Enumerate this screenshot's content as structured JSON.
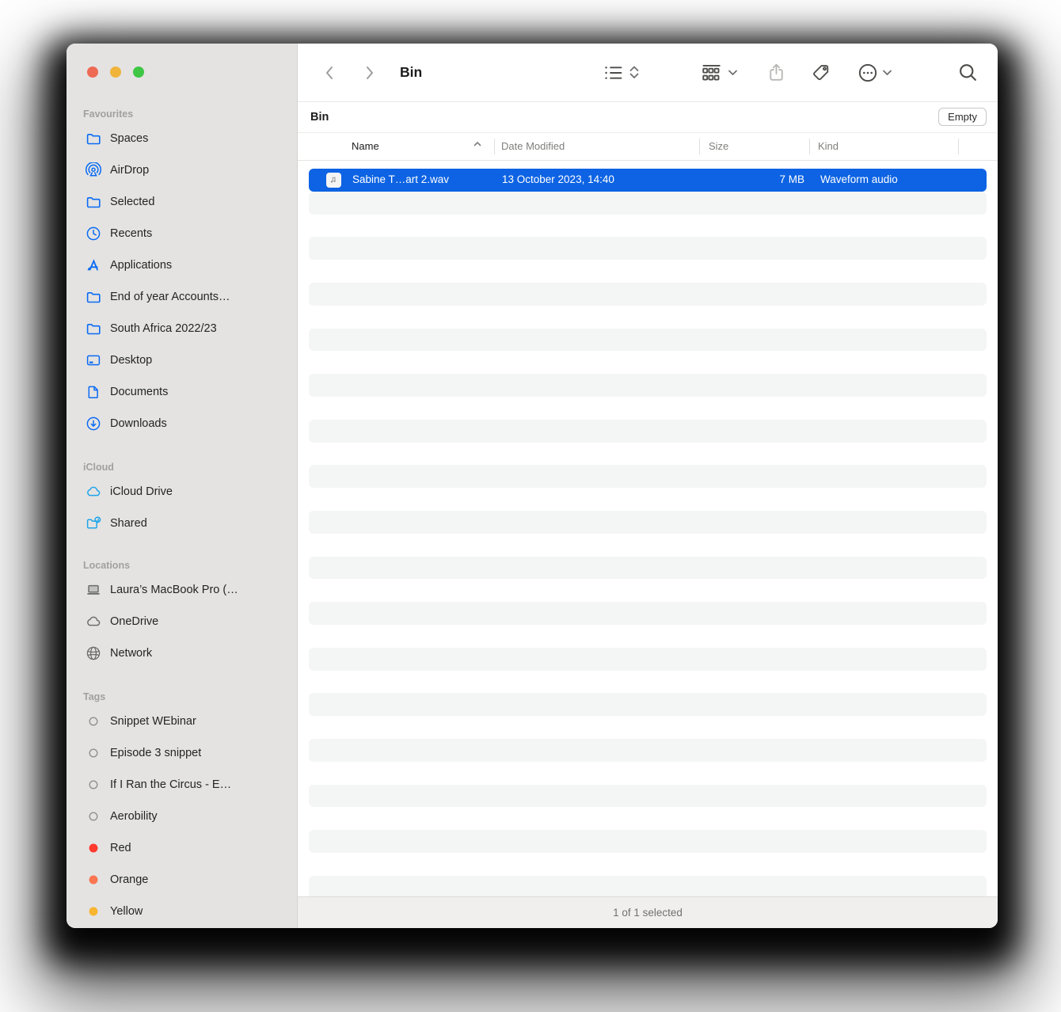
{
  "toolbar": {
    "title": "Bin",
    "icons": [
      "back-icon",
      "forward-icon",
      "list-view-icon",
      "view-picker-chevrons",
      "group-icon",
      "share-icon",
      "tag-icon",
      "more-icon",
      "search-icon"
    ]
  },
  "pathbar": {
    "location": "Bin",
    "empty_button": "Empty"
  },
  "columns": {
    "name": "Name",
    "date_modified": "Date Modified",
    "size": "Size",
    "kind": "Kind"
  },
  "file": {
    "name": "Sabine T…art 2.wav",
    "date_modified": "13 October 2023, 14:40",
    "size": "7 MB",
    "kind": "Waveform audio",
    "icon": "audio-file-icon",
    "selected": true
  },
  "status_bar": {
    "text": "1 of 1 selected"
  },
  "sidebar": {
    "sections": [
      {
        "title": "Favourites",
        "items": [
          {
            "label": "Spaces",
            "icon": "folder-icon"
          },
          {
            "label": "AirDrop",
            "icon": "airdrop-icon"
          },
          {
            "label": "Selected",
            "icon": "folder-icon"
          },
          {
            "label": "Recents",
            "icon": "clock-icon"
          },
          {
            "label": "Applications",
            "icon": "app-store-icon"
          },
          {
            "label": "End of year Accounts…",
            "icon": "folder-icon"
          },
          {
            "label": "South Africa 2022/23",
            "icon": "folder-icon"
          },
          {
            "label": "Desktop",
            "icon": "desktop-icon"
          },
          {
            "label": "Documents",
            "icon": "document-icon"
          },
          {
            "label": "Downloads",
            "icon": "download-icon"
          }
        ]
      },
      {
        "title": "iCloud",
        "items": [
          {
            "label": "iCloud Drive",
            "icon": "cloud-icon"
          },
          {
            "label": "Shared",
            "icon": "shared-folder-icon"
          }
        ]
      },
      {
        "title": "Locations",
        "items": [
          {
            "label": "Laura’s MacBook Pro (…",
            "icon": "laptop-icon"
          },
          {
            "label": "OneDrive",
            "icon": "cloud-icon"
          },
          {
            "label": "Network",
            "icon": "globe-icon"
          }
        ]
      },
      {
        "title": "Tags",
        "items": [
          {
            "label": "Snippet WEbinar",
            "icon": "tag-circle-icon",
            "color": null
          },
          {
            "label": "Episode 3 snippet",
            "icon": "tag-circle-icon",
            "color": null
          },
          {
            "label": "If I Ran the Circus - E…",
            "icon": "tag-circle-icon",
            "color": null
          },
          {
            "label": "Aerobility",
            "icon": "tag-circle-icon",
            "color": null
          },
          {
            "label": "Red",
            "icon": "tag-circle-icon",
            "color": "#ff3a2f"
          },
          {
            "label": "Orange",
            "icon": "tag-circle-icon",
            "color": "#f97650"
          },
          {
            "label": "Yellow",
            "icon": "tag-circle-icon",
            "color": "#f7b530"
          }
        ]
      }
    ]
  },
  "colors": {
    "selection_blue": "#0d63e3",
    "sidebar_icon_blue": "#0a6bf2",
    "icloud_icon_cyan": "#1ea5e9",
    "tag_red": "#ff3a2f",
    "tag_orange": "#f97650",
    "tag_yellow": "#f7b530"
  }
}
